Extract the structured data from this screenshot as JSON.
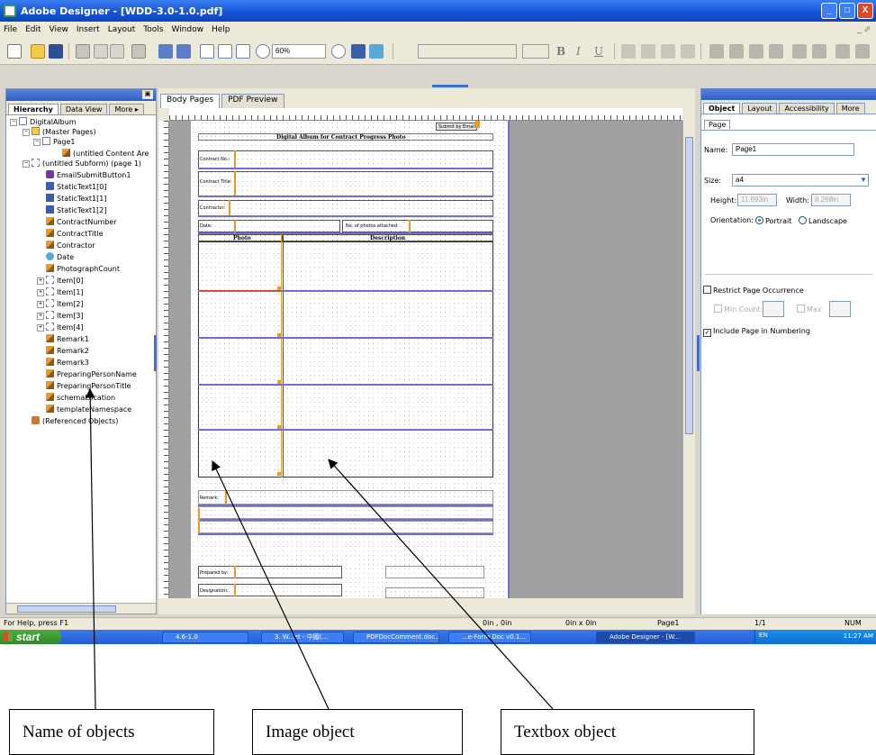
{
  "window": {
    "title": "Adobe Designer - [WDD-3.0-1.0.pdf]",
    "buttons": [
      "_",
      "□",
      "X"
    ]
  },
  "menu": [
    "File",
    "Edit",
    "View",
    "Insert",
    "Layout",
    "Tools",
    "Window",
    "Help"
  ],
  "toolbar": {
    "zoom": "60%",
    "bold": "B",
    "italic": "I",
    "underline": "U"
  },
  "hierarchy": {
    "tabs": [
      "Hierarchy",
      "Data View",
      "More ▸"
    ],
    "items": [
      "DigitalAlbum",
      "(Master Pages)",
      "Page1",
      "(untitled Content Are",
      "(untitled Subform) (page 1)",
      "EmailSubmitButton1",
      "StaticText1[0]",
      "StaticText1[1]",
      "StaticText1[2]",
      "ContractNumber",
      "ContractTitle",
      "Contractor",
      "Date",
      "PhotographCount",
      "Item[0]",
      "Item[1]",
      "Item[2]",
      "Item[3]",
      "Item[4]",
      "Remark1",
      "Remark2",
      "Remark3",
      "PreparingPersonName",
      "PreparingPersonTitle",
      "schemaLocation",
      "templateNamespace",
      "(Referenced Objects)"
    ]
  },
  "document": {
    "tabs": [
      "Body Pages",
      "PDF Preview"
    ],
    "form": {
      "submit": "Submit by Email",
      "title": "Digital Album for Contract Progress Photo",
      "contract_no": "Contract No.:",
      "contract_title": "Contract Title:",
      "contractor": "Contractor:",
      "date": "Date:",
      "photos_attached": "No. of photos attached:",
      "col_photo": "Photo",
      "col_description": "Description",
      "remark": "Remark:",
      "prepared_by": "Prepared by:",
      "designation": "Designation:"
    }
  },
  "object_panel": {
    "tabs": [
      "Object",
      "Layout",
      "Accessibility",
      "More"
    ],
    "subtab": "Page",
    "name_label": "Name:",
    "name_value": "Page1",
    "size_label": "Size:",
    "size_value": "a4",
    "height_label": "Height:",
    "height_value": "11.693in",
    "width_label": "Width:",
    "width_value": "8.268in",
    "orientation_label": "Orientation:",
    "portrait": "Portrait",
    "landscape": "Landscape",
    "restrict": "Restrict Page Occurrence",
    "min_count": "Min Count:",
    "max": "Max:",
    "include_numbering": "Include Page in Numbering"
  },
  "status": {
    "help": "For Help, press F1",
    "pos1": "0in , 0in",
    "pos2": "0in x 0in",
    "page": "Page1",
    "pages": "1/1",
    "num": "NUM"
  },
  "taskbar": {
    "start": "start",
    "tasks": [
      "4.6-1.0",
      "3. W...et - 中國(...",
      "PDFDocComment.doc...",
      "...e-Form Doc v0.1...",
      "Adobe Designer - [W..."
    ],
    "lang": "EN",
    "clock": "11:27 AM"
  },
  "annotations": {
    "names": "Name of objects",
    "image": "Image object",
    "textbox": "Textbox object"
  }
}
